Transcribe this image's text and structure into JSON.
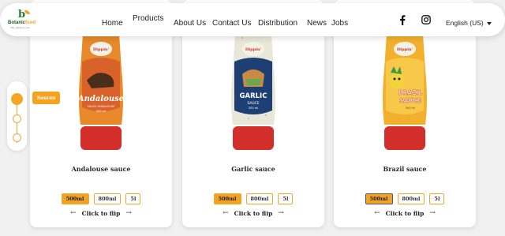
{
  "nav": {
    "logo_brand_main": "Botanic",
    "logo_brand_accent": "food",
    "logo_tagline": "from nature to you",
    "items": [
      "Home",
      "Products",
      "About Us",
      "Contact Us",
      "Distribution",
      "News",
      "Jobs"
    ],
    "social": [
      "facebook-icon",
      "instagram-icon"
    ],
    "language": "English (US)"
  },
  "stepper": {
    "active_label": "Sauces",
    "steps": 3,
    "active_index": 0
  },
  "products": [
    {
      "name": "Andalouse sauce",
      "label_title": "Andalouse",
      "label_sub": "SAUCE ANDALOUSE",
      "label_vol": "500 ml",
      "sizes": [
        "500ml",
        "800ml",
        "5l"
      ],
      "active_size": 0,
      "flip": "Click to flip",
      "colors": {
        "body": "#e8892b",
        "label": "#d9622a",
        "cap": "#d42e2a"
      }
    },
    {
      "name": "Garlic sauce",
      "label_title": "GARLIC",
      "label_sub": "SAUCE",
      "label_vol": "500 ml",
      "sizes": [
        "500ml",
        "800ml",
        "5l"
      ],
      "active_size": 0,
      "flip": "Click to flip",
      "colors": {
        "body": "#e9e7d8",
        "label": "#1e3f73",
        "cap": "#d42e2a"
      }
    },
    {
      "name": "Brazil sauce",
      "label_title": "BRAZIL",
      "label_sub": "SAUCE",
      "label_vol": "500 ml",
      "sizes": [
        "500ml",
        "800ml",
        "5l"
      ],
      "active_size": 0,
      "flip": "Click to flip",
      "colors": {
        "body": "#f2b02c",
        "label": "#f7c84a",
        "cap": "#d42e2a"
      }
    }
  ],
  "brand_badge": "Dippin'",
  "accent_color": "#f4a320"
}
